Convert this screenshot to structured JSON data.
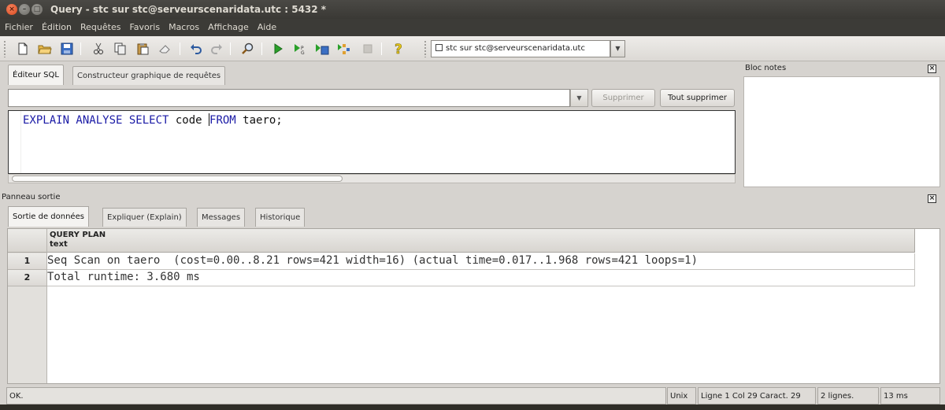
{
  "window": {
    "title": "Query - stc sur stc@serveurscenaridata.utc : 5432 *"
  },
  "menu": [
    "Fichier",
    "Édition",
    "Requêtes",
    "Favoris",
    "Macros",
    "Affichage",
    "Aide"
  ],
  "toolbar": {
    "icons": [
      "new-file-icon",
      "open-folder-icon",
      "save-icon",
      "cut-icon",
      "copy-icon",
      "paste-icon",
      "eraser-icon",
      "undo-icon",
      "redo-icon",
      "find-icon",
      "execute-icon",
      "execute-pgscript-icon",
      "execute-to-file-icon",
      "explain-icon",
      "stop-icon",
      "help-icon"
    ],
    "connection": "stc sur stc@serveurscenaridata.utc"
  },
  "editor": {
    "tabs": [
      "Éditeur SQL",
      "Constructeur graphique de requêtes"
    ],
    "delete_label": "Supprimer",
    "delete_all_label": "Tout supprimer",
    "sql": {
      "kw1": "EXPLAIN ANALYSE SELECT",
      "t1": " code ",
      "kw2": "FROM",
      "t2": " taero;"
    }
  },
  "notes": {
    "title": "Bloc notes"
  },
  "output": {
    "title": "Panneau sortie",
    "tabs": [
      "Sortie de données",
      "Expliquer (Explain)",
      "Messages",
      "Historique"
    ],
    "column": {
      "name": "QUERY PLAN",
      "type": "text"
    },
    "rows": [
      {
        "num": "1",
        "value": "Seq Scan on taero  (cost=0.00..8.21 rows=421 width=16) (actual time=0.017..1.968 rows=421 loops=1)"
      },
      {
        "num": "2",
        "value": "Total runtime: 3.680 ms"
      }
    ]
  },
  "status": {
    "message": "OK.",
    "line_ending": "Unix",
    "position": "Ligne 1 Col 29 Caract. 29",
    "lines": "2 lignes.",
    "time": "13 ms"
  }
}
